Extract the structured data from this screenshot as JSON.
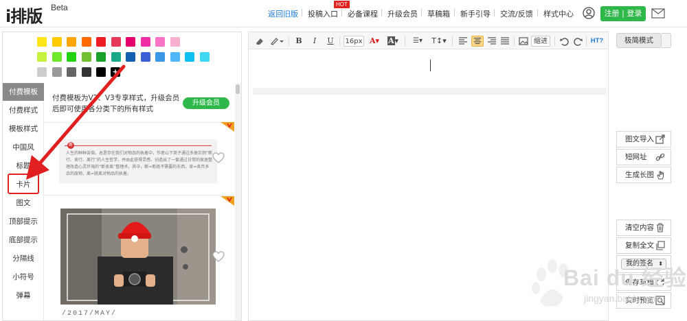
{
  "header": {
    "logo": "i排版",
    "logo_beta": "Beta",
    "hot_badge": "HOT",
    "nav": [
      {
        "label": "返回旧版",
        "active": true
      },
      {
        "label": "投稿入口",
        "active": false
      },
      {
        "label": "必备课程",
        "active": false
      },
      {
        "label": "升级会员",
        "active": false
      },
      {
        "label": "草稿箱",
        "active": false
      },
      {
        "label": "新手引导",
        "active": false
      },
      {
        "label": "交流/反馈",
        "active": false
      },
      {
        "label": "样式中心",
        "active": false
      }
    ],
    "register_label": "注册 | 登录",
    "icons": {
      "user": "user-circle-icon",
      "mail": "mail-icon"
    }
  },
  "colors": {
    "accent_green": "#2fb84a",
    "link_blue": "#1a7ad6",
    "annotation_red": "#e02020",
    "swatches_row1": [
      "#ffe61a",
      "#ffcc00",
      "#ffa400",
      "#ff6a00",
      "#ee1c24",
      "#e63a5a",
      "#e6006e",
      "#f02ea8",
      "#f774c7",
      "#f7b0cf"
    ],
    "swatches_row2": [
      "#c6f23d",
      "#6ee82a",
      "#21d311",
      "#71c132",
      "#19a02a",
      "#17a88c",
      "#155fb0",
      "#3c5fd6",
      "#3c98e6",
      "#4fb6f7",
      "#10c0f0",
      "#3fd8f2"
    ],
    "swatches_row3": [
      "#cccccc",
      "#999999",
      "#666666",
      "#333333",
      "#000000"
    ]
  },
  "left_panel": {
    "add_swatch_label": "+",
    "sidebar_items": [
      "付费模板",
      "付费样式",
      "模板样式",
      "中国风",
      "标题",
      "卡片",
      "图文",
      "顶部提示",
      "底部提示",
      "分隔线",
      "小符号",
      "弹幕"
    ],
    "promo_text": "付费模板为V2、V3专享样式，升级会员后即可使用各分类下的所有样式",
    "upgrade_label": "升级会员",
    "tpl_card_text": "人生的种种苦恼，总是存在我们对物品的执着中，作者山下英子通过多类实例“断行、舍行、离行”的人生哲学，并由此获得灵感，创造出了一套通过日常的家居整理改造心灵环境的“断舍离”整理术。其中，断=断绝不需要的东西，舍=舍弃多余的废物，离=脱离对物品的执着。",
    "tpl_card_dot": "断",
    "photo_caption": "/2017/MAY/"
  },
  "editor": {
    "font_size": "16px",
    "indent_label": "缩进",
    "html_label": "HT?",
    "icons": [
      "eraser-icon",
      "brush-icon",
      "bold-icon",
      "italic-icon",
      "underline-icon",
      "font-color-icon",
      "bg-color-icon",
      "list-icon",
      "text-size-icon",
      "align-left-icon",
      "align-center-icon",
      "align-right-icon",
      "align-justify-icon",
      "image-icon",
      "undo-icon",
      "redo-icon"
    ]
  },
  "right_panel": {
    "mode_label": "极简模式",
    "tools_top": [
      {
        "label": "图文导入",
        "icon": "import-icon"
      },
      {
        "label": "短网址",
        "icon": "link-icon"
      },
      {
        "label": "生成长图",
        "icon": "hand-icon"
      }
    ],
    "tools_bottom": [
      {
        "label": "清空内容",
        "icon": "trash-icon"
      },
      {
        "label": "复制全文",
        "icon": "copy-icon"
      }
    ],
    "signature_label": "我的签名",
    "tools_bottom2": [
      {
        "label": "保存草稿",
        "icon": "save-icon"
      },
      {
        "label": "实时预览",
        "icon": "preview-icon"
      }
    ]
  },
  "watermark": {
    "text": "Bai du 经验",
    "url": "jingyan.baidu.com"
  }
}
